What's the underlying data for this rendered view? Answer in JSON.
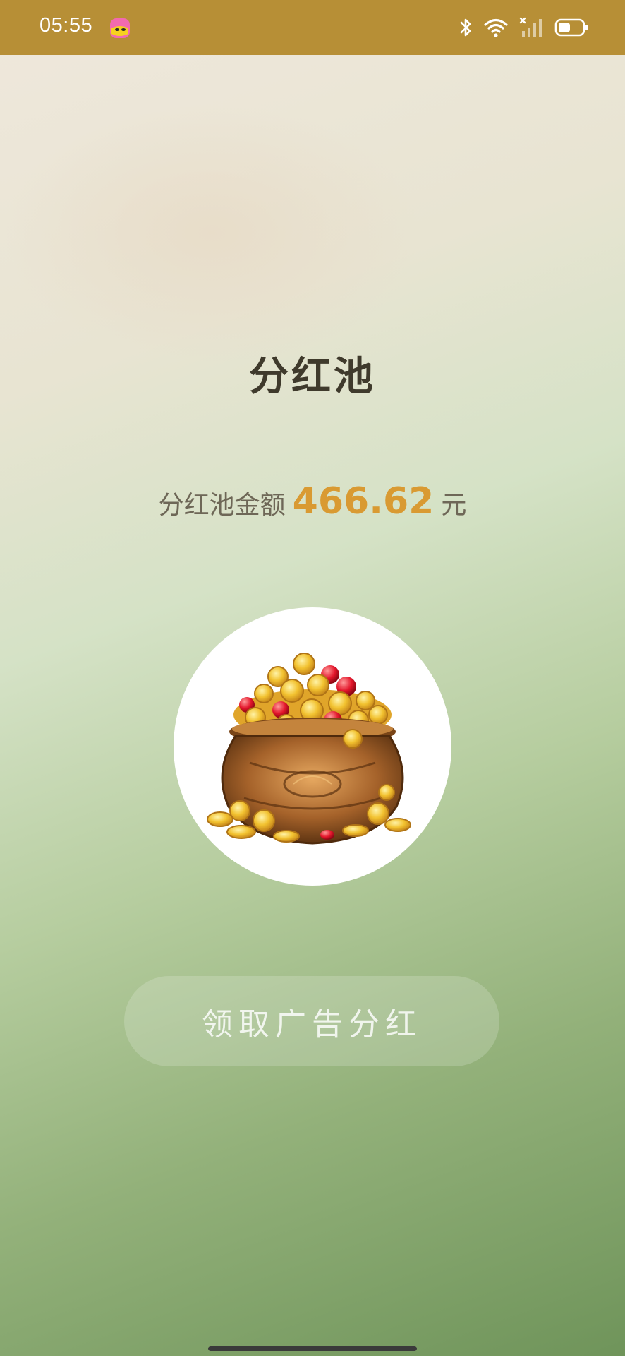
{
  "status_bar": {
    "time": "05:55",
    "background": "#b78f36",
    "icons": [
      "app-notification-icon",
      "bluetooth-icon",
      "wifi-icon",
      "signal-no-service-icon",
      "battery-icon"
    ]
  },
  "page": {
    "title": "分红池",
    "amount_label": "分红池金额",
    "amount_value": "466.62",
    "amount_unit": "元",
    "accent_color": "#d99a32",
    "image": "treasure-pot-of-gold-coins",
    "claim_button_label": "领取广告分红"
  }
}
